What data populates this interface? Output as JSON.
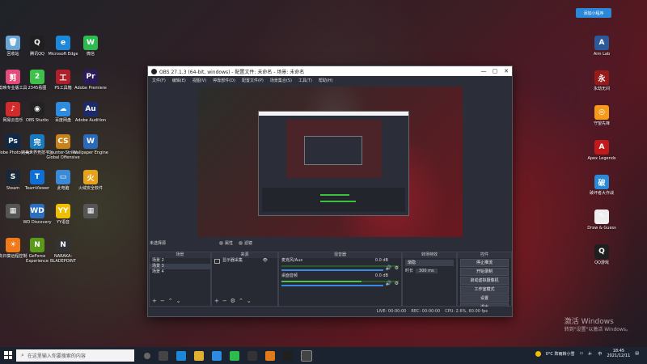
{
  "desktop": {
    "left_icons": [
      {
        "label": "回收站",
        "color": "#6aa5d6",
        "glyph": "🗑"
      },
      {
        "label": "腾讯QQ",
        "color": "#1f1f1f",
        "glyph": "Q"
      },
      {
        "label": "Microsoft Edge",
        "color": "#1e88d8",
        "glyph": "e"
      },
      {
        "label": "微信",
        "color": "#2dbb4f",
        "glyph": "W"
      },
      {
        "label": "剪映专业版工具",
        "color": "#e44b7a",
        "glyph": "剪"
      },
      {
        "label": "2345看图",
        "color": "#3ec14a",
        "glyph": "2"
      },
      {
        "label": "PS工具箱",
        "color": "#b0202a",
        "glyph": "工"
      },
      {
        "label": "Adobe Premiere",
        "color": "#2a1b5a",
        "glyph": "Pr"
      },
      {
        "label": "网易云音乐",
        "color": "#d12b2b",
        "glyph": "♪"
      },
      {
        "label": "OBS Studio",
        "color": "#222",
        "glyph": "◉"
      },
      {
        "label": "百度网盘",
        "color": "#2d8be0",
        "glyph": "☁"
      },
      {
        "label": "Adobe Audition",
        "color": "#1b2a6a",
        "glyph": "Au"
      },
      {
        "label": "Adobe Photoshop",
        "color": "#0f2a48",
        "glyph": "Ps"
      },
      {
        "label": "完美世界竞技平台",
        "color": "#1a7ac0",
        "glyph": "完"
      },
      {
        "label": "Counter-Strike: Global Offensive",
        "color": "#c7821c",
        "glyph": "CS"
      },
      {
        "label": "Wallpaper Engine",
        "color": "#2a6ab8",
        "glyph": "W"
      },
      {
        "label": "Steam",
        "color": "#1b2838",
        "glyph": "S"
      },
      {
        "label": "TeamViewer",
        "color": "#0e6fd6",
        "glyph": "T"
      },
      {
        "label": "此电脑",
        "color": "#3a8ad8",
        "glyph": "▭"
      },
      {
        "label": "火绒安全软件",
        "color": "#e6a21a",
        "glyph": "火"
      },
      {
        "label": "",
        "color": "#555",
        "glyph": "▦"
      },
      {
        "label": "WD Discovery",
        "color": "#2c6fc0",
        "glyph": "WD"
      },
      {
        "label": "YY语音",
        "color": "#f0c000",
        "glyph": "YY"
      },
      {
        "label": "",
        "color": "#555",
        "glyph": "▦"
      },
      {
        "label": "向日葵远程控制",
        "color": "#f07a1a",
        "glyph": "☀"
      },
      {
        "label": "GeForce Experience",
        "color": "#5a9a1a",
        "glyph": "N"
      },
      {
        "label": "NARAKA: BLADEPOINT",
        "color": "#333",
        "glyph": "N"
      }
    ],
    "right_icons": [
      {
        "label": "Aim Lab",
        "color": "#2a5a9a",
        "glyph": "A"
      },
      {
        "label": "永劫无间",
        "color": "#9a1a1a",
        "glyph": "永"
      },
      {
        "label": "守望先锋",
        "color": "#f59a1a",
        "glyph": "◎"
      },
      {
        "label": "Apex Legends",
        "color": "#c01a1a",
        "glyph": "A"
      },
      {
        "label": "破坏者大作战",
        "color": "#2a8ad8",
        "glyph": "破"
      },
      {
        "label": "Draw & Guess",
        "color": "#eee",
        "glyph": "✎"
      },
      {
        "label": "QQ游戏",
        "color": "#1f1f1f",
        "glyph": "Q"
      }
    ],
    "top_right_badge": "添加小程序",
    "activate_title": "激活 Windows",
    "activate_sub": "转到\"设置\"以激活 Windows。"
  },
  "obs": {
    "title": "OBS 27.1.3 (64-bit, windows) - 配置文件: 未命名 - 场景: 未命名",
    "menu": [
      "文件(F)",
      "编辑(E)",
      "视图(V)",
      "停靠部件(D)",
      "配置文件(P)",
      "场景集合(S)",
      "工具(T)",
      "帮助(H)"
    ],
    "no_source": "未选择源",
    "props_label": "属性",
    "filters_label": "滤镜",
    "docks": {
      "scenes": {
        "title": "场景",
        "items": [
          "场景 2",
          "场景 3",
          "场景 4"
        ],
        "selected": 1
      },
      "sources": {
        "title": "来源",
        "items": [
          "显示器采集"
        ]
      },
      "mixer": {
        "title": "混音器",
        "ch1": "麦克风/Aux",
        "ch1_db": "0.0 dB",
        "ch2": "桌面音频",
        "ch2_db": "0.0 dB"
      },
      "transitions": {
        "title": "转场特效",
        "type": "渐隐",
        "duration_label": "时长",
        "duration": "300 ms"
      },
      "controls": {
        "title": "控件",
        "buttons": [
          "停止推流",
          "开始录制",
          "启动虚拟摄像机",
          "工作室模式",
          "设置",
          "退出"
        ]
      }
    },
    "status": {
      "live": "LIVE: 00:00:00",
      "rec": "REC: 00:00:00",
      "cpu": "CPU: 2.6%, 60.00 fps"
    }
  },
  "taskbar": {
    "search_placeholder": "在这里输入你要搜索的内容",
    "temp": "0°C 阵雨转小雪",
    "time": "18:45",
    "date": "2021/12/11"
  }
}
